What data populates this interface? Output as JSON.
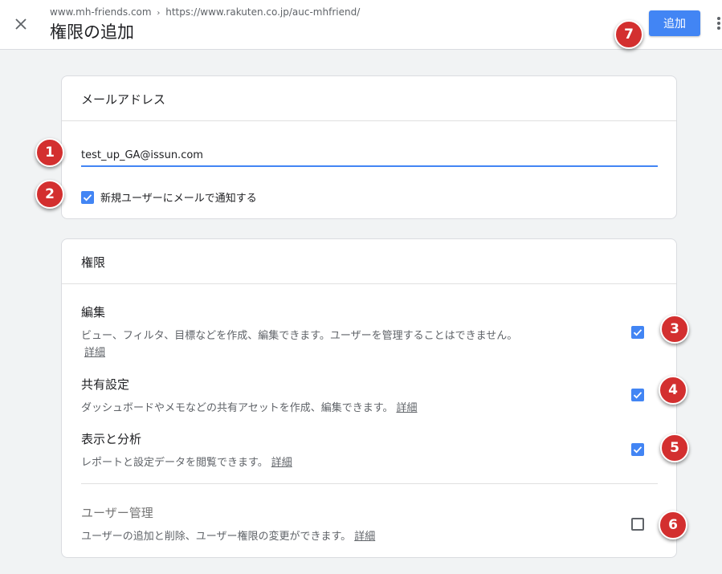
{
  "header": {
    "site": "www.mh-friends.com",
    "separator": "›",
    "url": "https://www.rakuten.co.jp/auc-mhfriend/",
    "title": "権限の追加",
    "add_label": "追加"
  },
  "email_section": {
    "title": "メールアドレス",
    "email_value": "test_up_GA@issun.com",
    "notify_label": "新規ユーザーにメールで通知する",
    "notify_checked": true
  },
  "permissions": {
    "title": "権限",
    "detail_label": "詳細",
    "items": [
      {
        "title": "編集",
        "description": "ビュー、フィルタ、目標などを作成、編集できます。ユーザーを管理することはできません。",
        "checked": true
      },
      {
        "title": "共有設定",
        "description": "ダッシュボードやメモなどの共有アセットを作成、編集できます。",
        "checked": true
      },
      {
        "title": "表示と分析",
        "description": "レポートと設定データを閲覧できます。",
        "checked": true
      },
      {
        "title": "ユーザー管理",
        "description": "ユーザーの追加と削除、ユーザー権限の変更ができます。",
        "checked": false
      }
    ]
  },
  "annotations": [
    "1",
    "2",
    "3",
    "4",
    "5",
    "6",
    "7"
  ],
  "colors": {
    "accent": "#4285f4",
    "badge": "#d32f2f"
  }
}
